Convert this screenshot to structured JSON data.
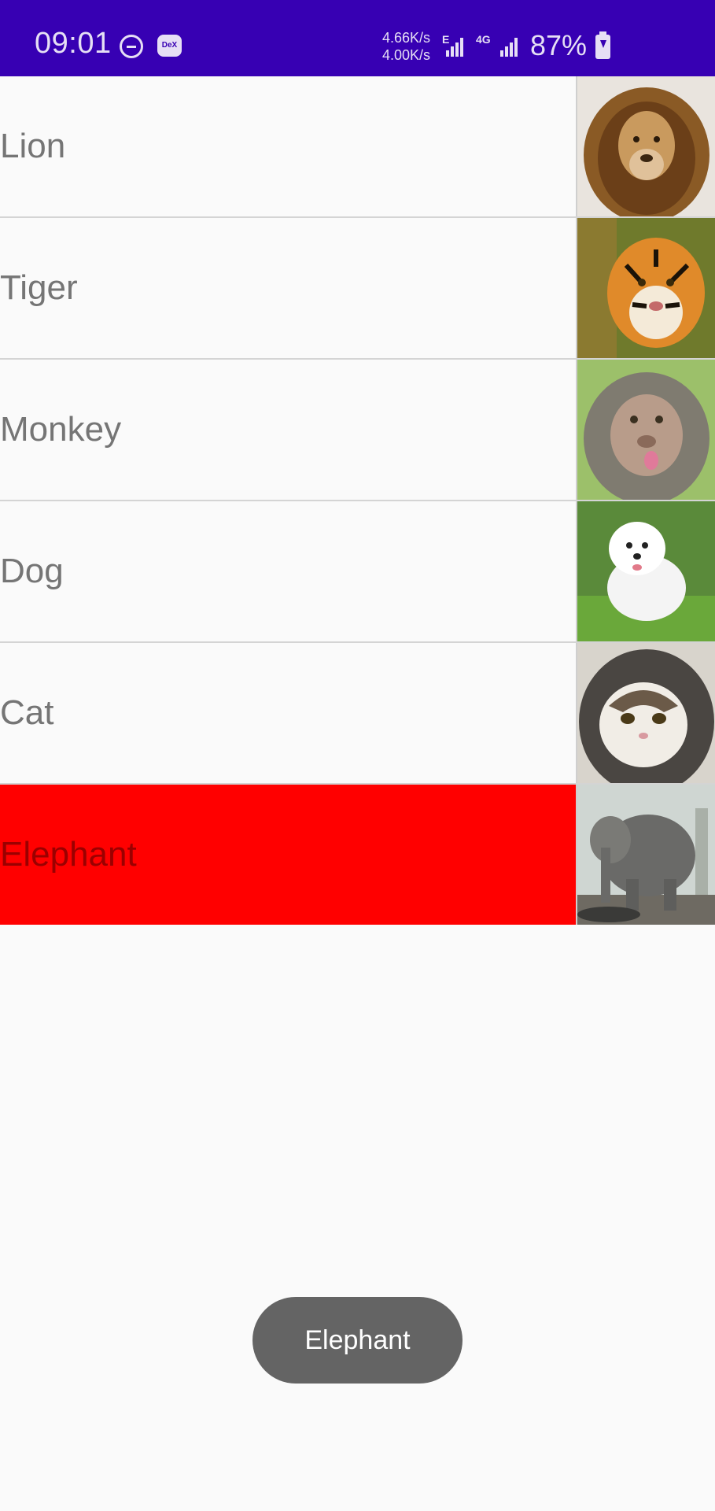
{
  "status_bar": {
    "time": "09:01",
    "net_up": "4.66K/s",
    "net_down": "4.00K/s",
    "net_label_1": "E",
    "net_label_2": "4G",
    "battery": "87%",
    "icons": [
      "do-not-disturb-icon",
      "dex-icon",
      "signal-icon",
      "signal-icon",
      "battery-charging-icon"
    ],
    "dex_badge": "DeX",
    "bar_color": "#3700b3"
  },
  "list": {
    "items": [
      {
        "label": "Lion",
        "image": "lion-photo",
        "selected": false
      },
      {
        "label": "Tiger",
        "image": "tiger-photo",
        "selected": false
      },
      {
        "label": "Monkey",
        "image": "monkey-photo",
        "selected": false
      },
      {
        "label": "Dog",
        "image": "dog-photo",
        "selected": false
      },
      {
        "label": "Cat",
        "image": "cat-photo",
        "selected": false
      },
      {
        "label": "Elephant",
        "image": "elephant-photo",
        "selected": true
      }
    ],
    "selected_color": "#ff0000"
  },
  "toast": {
    "text": "Elephant"
  }
}
